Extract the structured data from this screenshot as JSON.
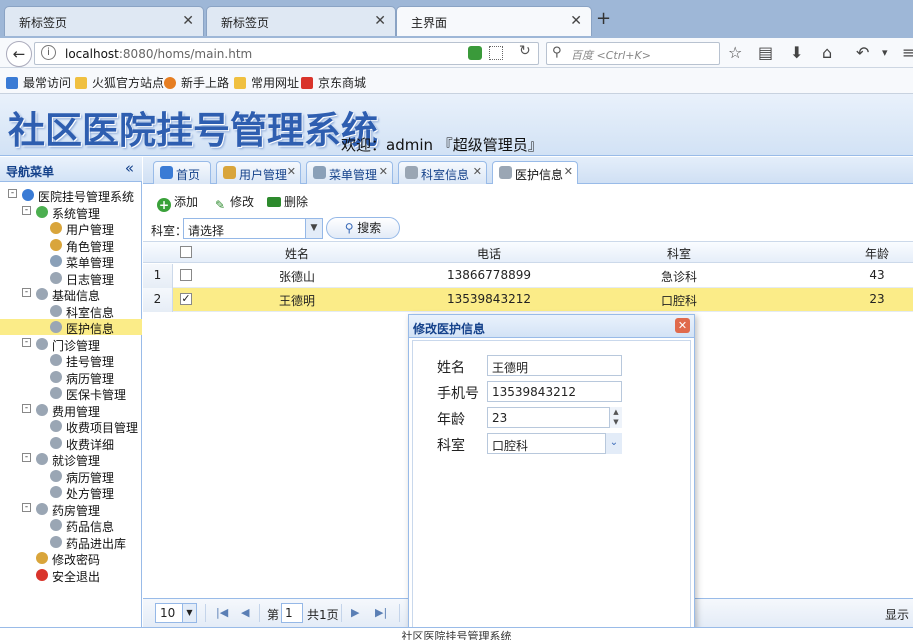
{
  "browser": {
    "tabs": [
      {
        "label": "新标签页",
        "active": false
      },
      {
        "label": "新标签页",
        "active": false
      },
      {
        "label": "主界面",
        "active": true
      }
    ],
    "new_tab": "+",
    "url_host": "localhost",
    "url_rest": ":8080/homs/main.htm",
    "search_placeholder": "百度 <Ctrl+K>",
    "bookmarks": [
      "最常访问",
      "火狐官方站点",
      "新手上路",
      "常用网址",
      "京东商城"
    ]
  },
  "app": {
    "title": "社区医院挂号管理系统",
    "welcome": "欢迎：admin 『超级管理员』"
  },
  "nav": {
    "title": "导航菜单",
    "collapse": "«",
    "tree": [
      {
        "label": "医院挂号管理系统",
        "level": 0,
        "toggle": "-",
        "color": "#3a7bd5"
      },
      {
        "label": "系统管理",
        "level": 1,
        "toggle": "-",
        "color": "#4caf50"
      },
      {
        "label": "用户管理",
        "level": 2,
        "color": "#d9a53b"
      },
      {
        "label": "角色管理",
        "level": 2,
        "color": "#d9a53b"
      },
      {
        "label": "菜单管理",
        "level": 2,
        "color": "#8aa0b8"
      },
      {
        "label": "日志管理",
        "level": 2,
        "color": "#9aa6b4"
      },
      {
        "label": "基础信息",
        "level": 1,
        "toggle": "-",
        "color": "#9aa6b4"
      },
      {
        "label": "科室信息",
        "level": 2,
        "color": "#9aa6b4"
      },
      {
        "label": "医护信息",
        "level": 2,
        "color": "#9aa6b4",
        "selected": true
      },
      {
        "label": "门诊管理",
        "level": 1,
        "toggle": "-",
        "color": "#9aa6b4"
      },
      {
        "label": "挂号管理",
        "level": 2,
        "color": "#9aa6b4"
      },
      {
        "label": "病历管理",
        "level": 2,
        "color": "#9aa6b4"
      },
      {
        "label": "医保卡管理",
        "level": 2,
        "color": "#9aa6b4"
      },
      {
        "label": "费用管理",
        "level": 1,
        "toggle": "-",
        "color": "#9aa6b4"
      },
      {
        "label": "收费项目管理",
        "level": 2,
        "color": "#9aa6b4"
      },
      {
        "label": "收费详细",
        "level": 2,
        "color": "#9aa6b4"
      },
      {
        "label": "就诊管理",
        "level": 1,
        "toggle": "-",
        "color": "#9aa6b4"
      },
      {
        "label": "病历管理",
        "level": 2,
        "color": "#9aa6b4"
      },
      {
        "label": "处方管理",
        "level": 2,
        "color": "#9aa6b4"
      },
      {
        "label": "药房管理",
        "level": 1,
        "toggle": "-",
        "color": "#9aa6b4"
      },
      {
        "label": "药品信息",
        "level": 2,
        "color": "#9aa6b4"
      },
      {
        "label": "药品进出库",
        "level": 2,
        "color": "#9aa6b4"
      },
      {
        "label": "修改密码",
        "level": 1,
        "color": "#d9a53b"
      },
      {
        "label": "安全退出",
        "level": 1,
        "color": "#d9342b"
      }
    ]
  },
  "content": {
    "tabs": [
      {
        "label": "首页",
        "closable": false,
        "color": "#3a7bd5"
      },
      {
        "label": "用户管理",
        "closable": true,
        "color": "#d9a53b"
      },
      {
        "label": "菜单管理",
        "closable": true,
        "color": "#8aa0b8"
      },
      {
        "label": "科室信息",
        "closable": true,
        "color": "#9aa6b4"
      },
      {
        "label": "医护信息",
        "closable": true,
        "color": "#9aa6b4",
        "active": true
      }
    ],
    "toolbar": {
      "add": "添加",
      "edit": "修改",
      "delete": "删除"
    },
    "filter": {
      "label": "科室：",
      "select_value": "请选择",
      "search": "搜索"
    },
    "grid": {
      "columns": [
        "姓名",
        "电话",
        "科室",
        "年龄"
      ],
      "rows": [
        {
          "num": "1",
          "checked": false,
          "name": "张德山",
          "phone": "13866778899",
          "dept": "急诊科",
          "age": "43"
        },
        {
          "num": "2",
          "checked": true,
          "name": "王德明",
          "phone": "13539843212",
          "dept": "口腔科",
          "age": "23"
        }
      ]
    },
    "pager": {
      "page_size": "10",
      "page_label": "第",
      "page_value": "1",
      "total": "共1页",
      "display": "显示"
    }
  },
  "dialog": {
    "title": "修改医护信息",
    "fields": [
      {
        "label": "姓名",
        "value": "王德明"
      },
      {
        "label": "手机号",
        "value": "13539843212"
      },
      {
        "label": "年龄",
        "value": "23"
      },
      {
        "label": "科室",
        "value": "口腔科"
      }
    ]
  },
  "footer": "社区医院挂号管理系统"
}
